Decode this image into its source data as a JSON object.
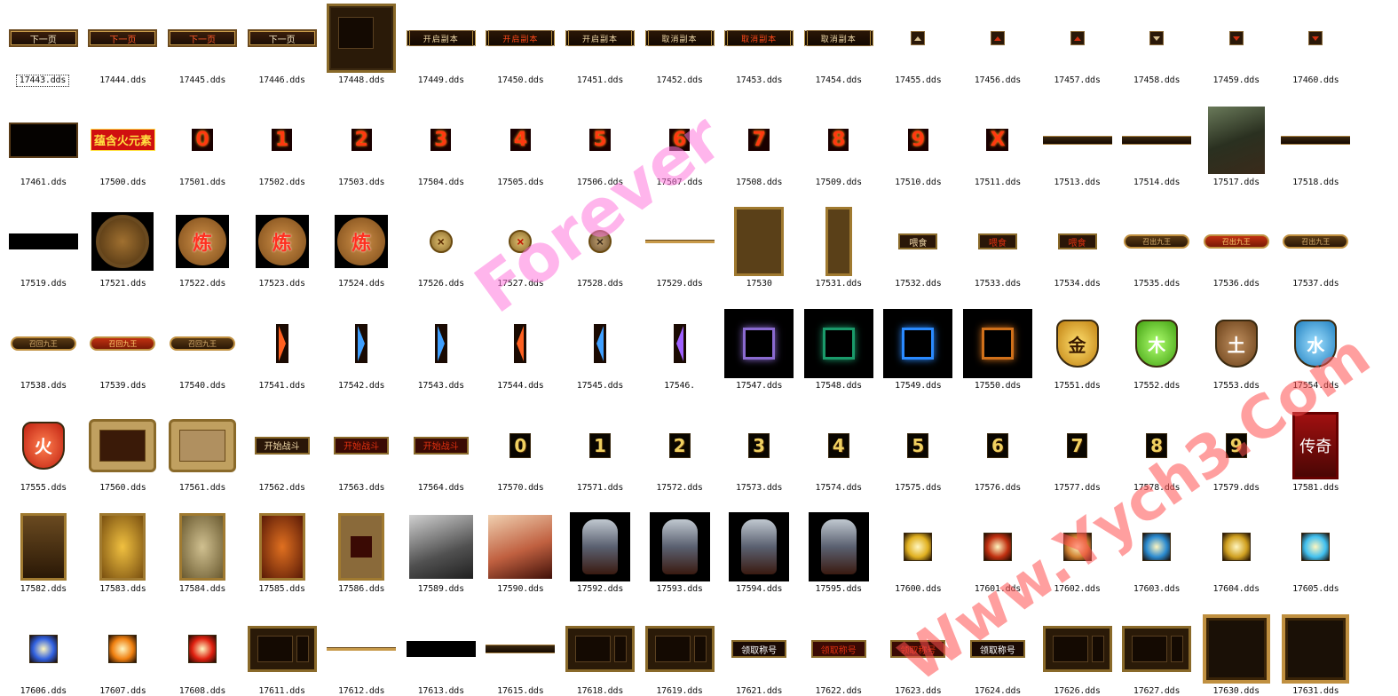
{
  "items": [
    {
      "file": "17443.dds",
      "kind": "btn",
      "label": "下一页",
      "selected": true
    },
    {
      "file": "17444.dds",
      "kind": "btn",
      "label": "下一页",
      "variant": "red"
    },
    {
      "file": "17445.dds",
      "kind": "btn",
      "label": "下一页",
      "variant": "red"
    },
    {
      "file": "17446.dds",
      "kind": "btn",
      "label": "下一页"
    },
    {
      "file": "17448.dds",
      "kind": "panel"
    },
    {
      "file": "17449.dds",
      "kind": "orn",
      "label": "开启副本"
    },
    {
      "file": "17450.dds",
      "kind": "orn",
      "label": "开启副本",
      "variant": "red"
    },
    {
      "file": "17451.dds",
      "kind": "orn",
      "label": "开启副本"
    },
    {
      "file": "17452.dds",
      "kind": "orn",
      "label": "取消副本"
    },
    {
      "file": "17453.dds",
      "kind": "orn",
      "label": "取消副本",
      "variant": "red"
    },
    {
      "file": "17454.dds",
      "kind": "orn",
      "label": "取消副本"
    },
    {
      "file": "17455.dds",
      "kind": "arrow-up"
    },
    {
      "file": "17456.dds",
      "kind": "arrow-up",
      "variant": "red"
    },
    {
      "file": "17457.dds",
      "kind": "arrow-up",
      "variant": "red"
    },
    {
      "file": "17458.dds",
      "kind": "arrow-dn"
    },
    {
      "file": "17459.dds",
      "kind": "arrow-dn",
      "variant": "red"
    },
    {
      "file": "17460.dds",
      "kind": "arrow-dn",
      "variant": "red"
    },
    {
      "file": "17461.dds",
      "kind": "dark"
    },
    {
      "file": "17500.dds",
      "kind": "redtxt",
      "label": "蕴含火元素"
    },
    {
      "file": "17501.dds",
      "kind": "num",
      "label": "0"
    },
    {
      "file": "17502.dds",
      "kind": "num",
      "label": "1"
    },
    {
      "file": "17503.dds",
      "kind": "num",
      "label": "2"
    },
    {
      "file": "17504.dds",
      "kind": "num",
      "label": "3"
    },
    {
      "file": "17505.dds",
      "kind": "num",
      "label": "4"
    },
    {
      "file": "17506.dds",
      "kind": "num",
      "label": "5"
    },
    {
      "file": "17507.dds",
      "kind": "num",
      "label": "6"
    },
    {
      "file": "17508.dds",
      "kind": "num",
      "label": "7"
    },
    {
      "file": "17509.dds",
      "kind": "num",
      "label": "8"
    },
    {
      "file": "17510.dds",
      "kind": "num",
      "label": "9"
    },
    {
      "file": "17511.dds",
      "kind": "num",
      "label": "X"
    },
    {
      "file": "17513.dds",
      "kind": "line"
    },
    {
      "file": "17514.dds",
      "kind": "line"
    },
    {
      "file": "17517.dds",
      "kind": "photo"
    },
    {
      "file": "17518.dds",
      "kind": "line"
    },
    {
      "file": "17519.dds",
      "kind": "black"
    },
    {
      "file": "17521.dds",
      "kind": "disc"
    },
    {
      "file": "17522.dds",
      "kind": "coin",
      "label": "炼"
    },
    {
      "file": "17523.dds",
      "kind": "coin",
      "label": "炼"
    },
    {
      "file": "17524.dds",
      "kind": "coin",
      "label": "炼"
    },
    {
      "file": "17526.dds",
      "kind": "x"
    },
    {
      "file": "17527.dds",
      "kind": "x",
      "variant": "red"
    },
    {
      "file": "17528.dds",
      "kind": "x",
      "variant": "grey"
    },
    {
      "file": "17529.dds",
      "kind": "thin"
    },
    {
      "file": "17530",
      "kind": "frame"
    },
    {
      "file": "17531.dds",
      "kind": "frame",
      "variant": "narrow"
    },
    {
      "file": "17532.dds",
      "kind": "small",
      "label": "喂食"
    },
    {
      "file": "17533.dds",
      "kind": "small",
      "label": "喂食",
      "variant": "red"
    },
    {
      "file": "17534.dds",
      "kind": "small",
      "label": "喂食",
      "variant": "red"
    },
    {
      "file": "17535.dds",
      "kind": "oval",
      "label": "召出九王"
    },
    {
      "file": "17536.dds",
      "kind": "oval",
      "label": "召出九王",
      "variant": "red"
    },
    {
      "file": "17537.dds",
      "kind": "oval",
      "label": "召出九王"
    },
    {
      "file": "17538.dds",
      "kind": "oval",
      "label": "召回九王"
    },
    {
      "file": "17539.dds",
      "kind": "oval",
      "label": "召回九王",
      "variant": "red"
    },
    {
      "file": "17540.dds",
      "kind": "oval",
      "label": "召回九王"
    },
    {
      "file": "17541.dds",
      "kind": "tab"
    },
    {
      "file": "17542.dds",
      "kind": "tab",
      "variant": "blue"
    },
    {
      "file": "17543.dds",
      "kind": "tab",
      "variant": "blue"
    },
    {
      "file": "17544.dds",
      "kind": "tab",
      "variant": "l"
    },
    {
      "file": "17545.dds",
      "kind": "tab",
      "variant": "l blue"
    },
    {
      "file": "17546.",
      "kind": "tab",
      "variant": "l violet"
    },
    {
      "file": "17547.dds",
      "kind": "glow",
      "color": "#8a6ad0"
    },
    {
      "file": "17548.dds",
      "kind": "glow",
      "color": "#1a9a6a"
    },
    {
      "file": "17549.dds",
      "kind": "glow",
      "color": "#2a8aff"
    },
    {
      "file": "17550.dds",
      "kind": "glow",
      "color": "#d0701a"
    },
    {
      "file": "17551.dds",
      "kind": "shield",
      "label": "金",
      "variant": "gold"
    },
    {
      "file": "17552.dds",
      "kind": "shield",
      "label": "木",
      "variant": "green"
    },
    {
      "file": "17553.dds",
      "kind": "shield",
      "label": "土",
      "variant": "brown"
    },
    {
      "file": "17554.dds",
      "kind": "shield",
      "label": "水",
      "variant": "blue"
    },
    {
      "file": "17555.dds",
      "kind": "shield",
      "label": "火",
      "variant": "red"
    },
    {
      "file": "17560.dds",
      "kind": "scroll"
    },
    {
      "file": "17561.dds",
      "kind": "scroll",
      "variant": "light"
    },
    {
      "file": "17562.dds",
      "kind": "flat",
      "label": "开始战斗"
    },
    {
      "file": "17563.dds",
      "kind": "flat",
      "label": "开始战斗",
      "variant": "red"
    },
    {
      "file": "17564.dds",
      "kind": "flat",
      "label": "开始战斗",
      "variant": "red"
    },
    {
      "file": "17570.dds",
      "kind": "num2",
      "label": "0"
    },
    {
      "file": "17571.dds",
      "kind": "num2",
      "label": "1"
    },
    {
      "file": "17572.dds",
      "kind": "num2",
      "label": "2"
    },
    {
      "file": "17573.dds",
      "kind": "num2",
      "label": "3"
    },
    {
      "file": "17574.dds",
      "kind": "num2",
      "label": "4"
    },
    {
      "file": "17575.dds",
      "kind": "num2",
      "label": "5"
    },
    {
      "file": "17576.dds",
      "kind": "num2",
      "label": "6"
    },
    {
      "file": "17577.dds",
      "kind": "num2",
      "label": "7"
    },
    {
      "file": "17578.dds",
      "kind": "num2",
      "label": "8"
    },
    {
      "file": "17579.dds",
      "kind": "num2",
      "label": "9"
    },
    {
      "file": "17581.dds",
      "kind": "card",
      "variant": "banner",
      "label": "传奇"
    },
    {
      "file": "17582.dds",
      "kind": "card"
    },
    {
      "file": "17583.dds",
      "kind": "card",
      "variant": "gold"
    },
    {
      "file": "17584.dds",
      "kind": "card",
      "variant": "pale"
    },
    {
      "file": "17585.dds",
      "kind": "card",
      "variant": "red"
    },
    {
      "file": "17586.dds",
      "kind": "card",
      "variant": "hole"
    },
    {
      "file": "17589.dds",
      "kind": "tiger"
    },
    {
      "file": "17590.dds",
      "kind": "tiger",
      "variant": "color"
    },
    {
      "file": "17592.dds",
      "kind": "mon"
    },
    {
      "file": "17593.dds",
      "kind": "mon"
    },
    {
      "file": "17594.dds",
      "kind": "mon"
    },
    {
      "file": "17595.dds",
      "kind": "mon"
    },
    {
      "file": "17600.dds",
      "kind": "skill",
      "color": "#e0b020"
    },
    {
      "file": "17601.dds",
      "kind": "skill",
      "color": "#c03010"
    },
    {
      "file": "17602.dds",
      "kind": "skill",
      "color": "#d08030"
    },
    {
      "file": "17603.dds",
      "kind": "skill",
      "color": "#2a8ad0"
    },
    {
      "file": "17604.dds",
      "kind": "skill",
      "color": "#d0a020"
    },
    {
      "file": "17605.dds",
      "kind": "skill",
      "color": "#40c0f0"
    },
    {
      "file": "17606.dds",
      "kind": "skill",
      "color": "#3060e0"
    },
    {
      "file": "17607.dds",
      "kind": "skill",
      "color": "#f08010"
    },
    {
      "file": "17608.dds",
      "kind": "skill",
      "color": "#e02010"
    },
    {
      "file": "17611.dds",
      "kind": "win"
    },
    {
      "file": "17612.dds",
      "kind": "thin"
    },
    {
      "file": "17613.dds",
      "kind": "black"
    },
    {
      "file": "17615.dds",
      "kind": "line"
    },
    {
      "file": "17618.dds",
      "kind": "win"
    },
    {
      "file": "17619.dds",
      "kind": "win"
    },
    {
      "file": "17621.dds",
      "kind": "flat",
      "label": "领取称号",
      "variant": "plain"
    },
    {
      "file": "17622.dds",
      "kind": "flat",
      "label": "领取称号",
      "variant": "red"
    },
    {
      "file": "17623.dds",
      "kind": "flat",
      "label": "领取称号",
      "variant": "red"
    },
    {
      "file": "17624.dds",
      "kind": "flat",
      "label": "领取称号",
      "variant": "plain"
    },
    {
      "file": "17626.dds",
      "kind": "win"
    },
    {
      "file": "17627.dds",
      "kind": "win"
    },
    {
      "file": "17630.dds",
      "kind": "big"
    },
    {
      "file": "17631.dds",
      "kind": "big"
    }
  ],
  "watermarks": {
    "forever": "Forever",
    "site": "Www.Yych3.Com"
  }
}
